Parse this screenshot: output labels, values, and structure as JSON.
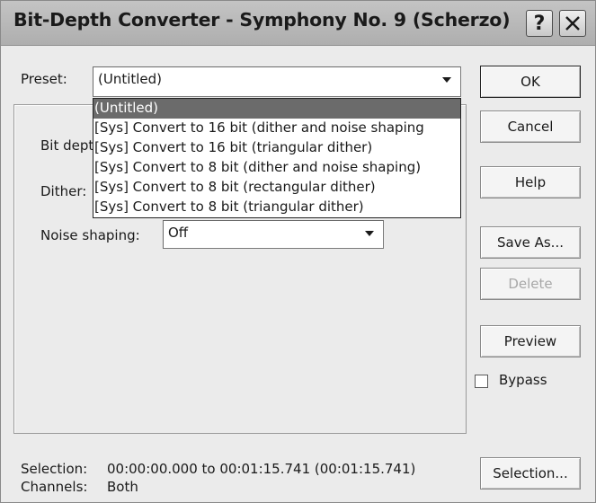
{
  "window": {
    "title": "Bit-Depth Converter - Symphony No. 9 (Scherzo)",
    "help_glyph": "?"
  },
  "preset": {
    "label": "Preset:",
    "value": "(Untitled)",
    "options": [
      "(Untitled)",
      "[Sys] Convert to 16 bit  (dither and noise shaping",
      "[Sys] Convert to 16 bit  (triangular dither)",
      "[Sys] Convert to 8 bit  (dither and noise shaping)",
      "[Sys] Convert to 8 bit  (rectangular dither)",
      "[Sys] Convert to 8 bit  (triangular dither)"
    ],
    "selected_index": 0
  },
  "fields": {
    "bit_depth_label": "Bit dept",
    "dither_label": "Dither:",
    "noise_shaping_label": "Noise shaping:",
    "noise_shaping_value": "Off"
  },
  "buttons": {
    "ok": "OK",
    "cancel": "Cancel",
    "help": "Help",
    "save_as": "Save As...",
    "delete": "Delete",
    "preview": "Preview",
    "selection": "Selection..."
  },
  "bypass": {
    "label": "Bypass",
    "checked": false
  },
  "status": {
    "selection_label": "Selection:",
    "selection_value": "00:00:00.000 to 00:01:15.741 (00:01:15.741)",
    "channels_label": "Channels:",
    "channels_value": "Both"
  },
  "colors": {
    "highlight": "#6b6b6b",
    "face": "#ebebeb"
  }
}
